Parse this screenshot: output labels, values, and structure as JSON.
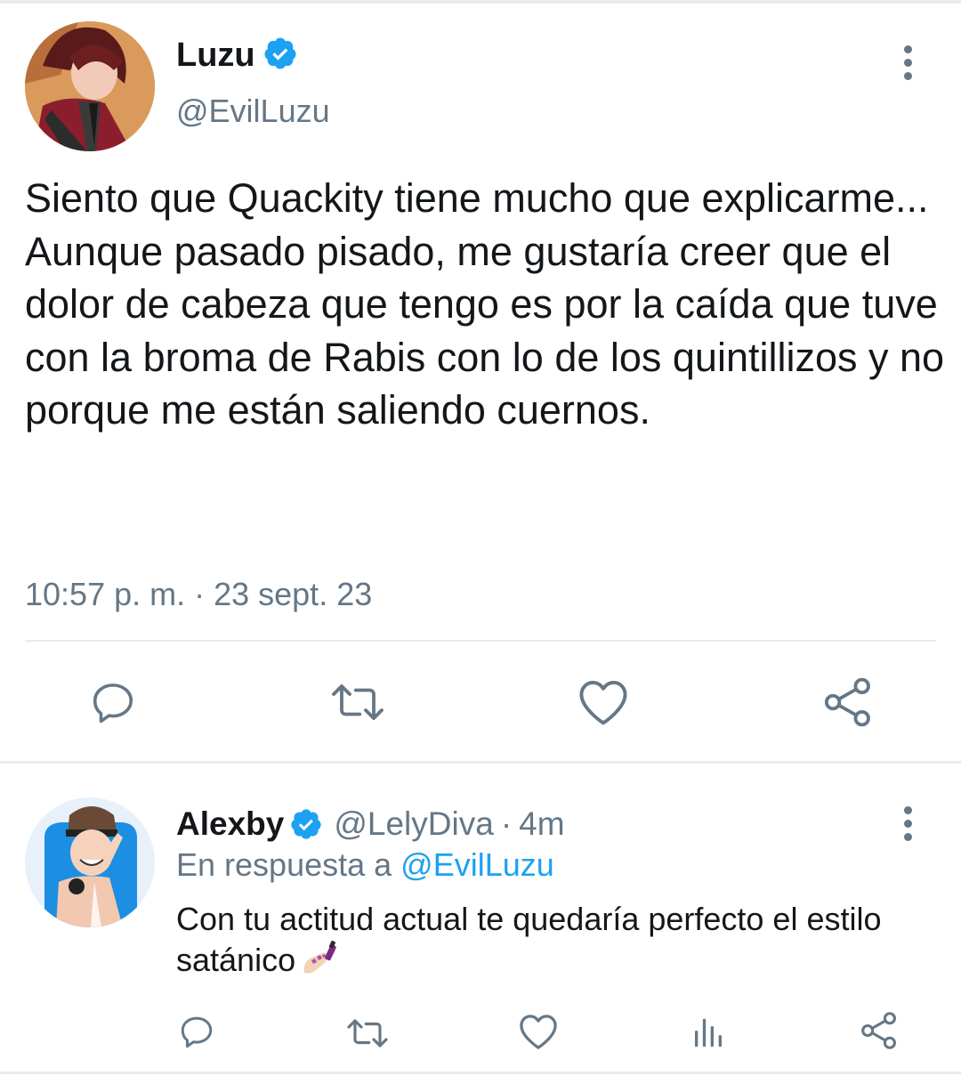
{
  "main_tweet": {
    "display_name": "Luzu",
    "handle": "@EvilLuzu",
    "verified": true,
    "text": "Siento que Quackity tiene mucho que explicarme...\nAunque pasado pisado, me gustaría creer que el dolor de cabeza que tengo es por la caída que tuve con la broma de Rabis con lo de los quintillizos y no porque me están saliendo cuernos.",
    "timestamp": "10:57 p. m. · 23 sept. 23",
    "actions": [
      "reply-icon",
      "retweet-icon",
      "like-icon",
      "share-icon"
    ]
  },
  "reply_tweet": {
    "display_name": "Alexby",
    "handle": "@LelyDiva",
    "separator": "·",
    "time": "4m",
    "verified": true,
    "reply_prefix": "En respuesta a",
    "reply_mention": "@EvilLuzu",
    "text": "Con tu actitud actual te quedaría perfecto el estilo satánico",
    "emoji": "nail-polish-emoji",
    "actions": [
      "reply-icon",
      "retweet-icon",
      "like-icon",
      "analytics-icon",
      "share-icon"
    ]
  },
  "colors": {
    "text_primary": "#14171a",
    "text_secondary": "#657786",
    "accent_blue": "#1da1f2",
    "divider": "#e6ecf0",
    "icon": "#657786"
  }
}
